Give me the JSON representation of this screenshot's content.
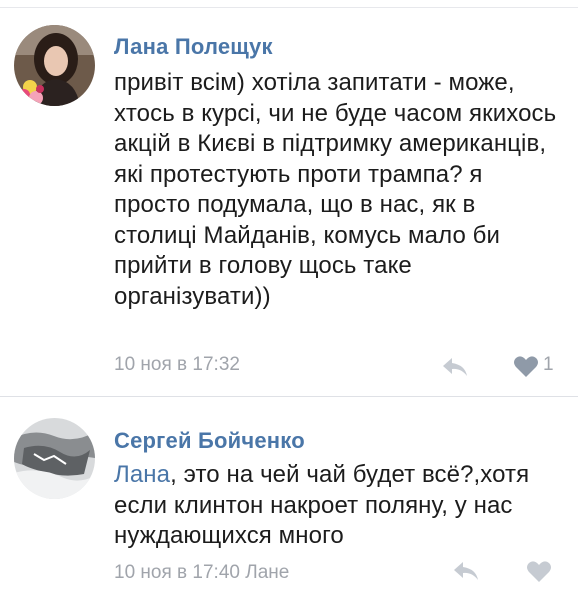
{
  "comments": [
    {
      "author": "Лана Полещук",
      "text": "привіт всім) хотіла запитати - може, хтось в курсі, чи не буде часом якихось акцій в Києві в підтримку американців, які протестують проти трампа? я просто подумала, що в нас, як в столиці Майданів, комусь мало би прийти в голову щось таке організувати))",
      "timestamp": "10 ноя в 17:32",
      "like_count": "1",
      "liked": true
    },
    {
      "author": "Сергей Бойченко",
      "mention": "Лана",
      "text": ", это на чей чай будет всё?,хотя если клинтон накроет поляну, у нас нуждающихся много",
      "timestamp": "10 ноя в 17:40 Лане",
      "liked": false
    }
  ],
  "colors": {
    "author": "#4a76a8",
    "meta": "#a0a4ab",
    "text": "#1c1c1c",
    "liked_icon": "#8f9aa8",
    "unliked_icon": "#c6cbd2"
  },
  "icons": {
    "reply": "reply-arrow-icon",
    "like": "heart-icon",
    "avatar": "user-avatar"
  }
}
